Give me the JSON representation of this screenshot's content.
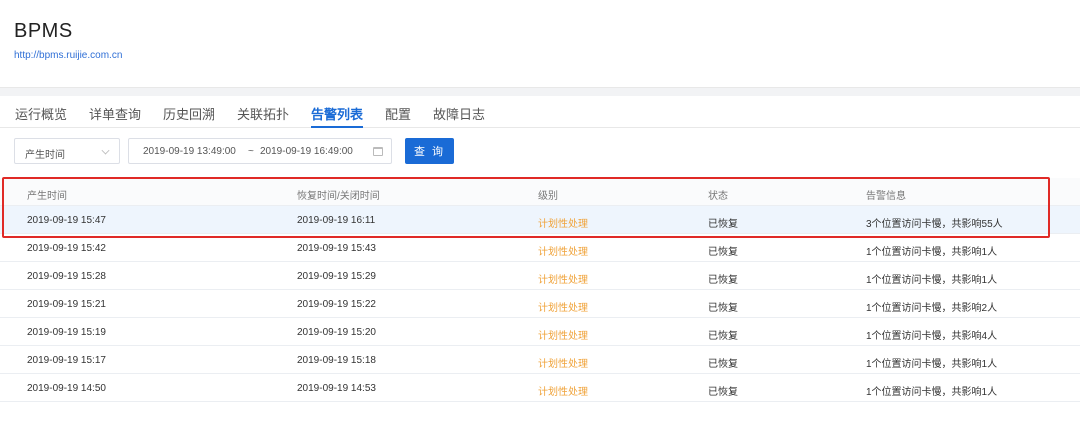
{
  "app": {
    "title": "BPMS",
    "url": "http://bpms.ruijie.com.cn"
  },
  "tabs": [
    {
      "label": "运行概览"
    },
    {
      "label": "详单查询"
    },
    {
      "label": "历史回溯"
    },
    {
      "label": "关联拓扑"
    },
    {
      "label": "告警列表",
      "active": true
    },
    {
      "label": "配置"
    },
    {
      "label": "故障日志"
    }
  ],
  "filter": {
    "time_type": "产生时间",
    "date_start": "2019-09-19 13:49:00",
    "date_sep": "~",
    "date_end": "2019-09-19 16:49:00",
    "query_label": "查 询"
  },
  "table": {
    "columns": [
      "产生时间",
      "恢复时间/关闭时间",
      "级别",
      "状态",
      "告警信息"
    ],
    "rows": [
      {
        "start": "2019-09-19 15:47",
        "end": "2019-09-19 16:11",
        "level": "计划性处理",
        "status": "已恢复",
        "info": "3个位置访问卡慢，共影响55人"
      },
      {
        "start": "2019-09-19 15:42",
        "end": "2019-09-19 15:43",
        "level": "计划性处理",
        "status": "已恢复",
        "info": "1个位置访问卡慢，共影响1人"
      },
      {
        "start": "2019-09-19 15:28",
        "end": "2019-09-19 15:29",
        "level": "计划性处理",
        "status": "已恢复",
        "info": "1个位置访问卡慢，共影响1人"
      },
      {
        "start": "2019-09-19 15:21",
        "end": "2019-09-19 15:22",
        "level": "计划性处理",
        "status": "已恢复",
        "info": "1个位置访问卡慢，共影响2人"
      },
      {
        "start": "2019-09-19 15:19",
        "end": "2019-09-19 15:20",
        "level": "计划性处理",
        "status": "已恢复",
        "info": "1个位置访问卡慢，共影响4人"
      },
      {
        "start": "2019-09-19 15:17",
        "end": "2019-09-19 15:18",
        "level": "计划性处理",
        "status": "已恢复",
        "info": "1个位置访问卡慢，共影响1人"
      },
      {
        "start": "2019-09-19 14:50",
        "end": "2019-09-19 14:53",
        "level": "计划性处理",
        "status": "已恢复",
        "info": "1个位置访问卡慢，共影响1人"
      }
    ]
  },
  "colors": {
    "accent": "#1a6bd6",
    "level_text": "#f0a33a",
    "highlight_border": "#e02a26"
  },
  "icons": {
    "select_arrow": "chevron-down-icon",
    "date_picker": "calendar-icon"
  }
}
